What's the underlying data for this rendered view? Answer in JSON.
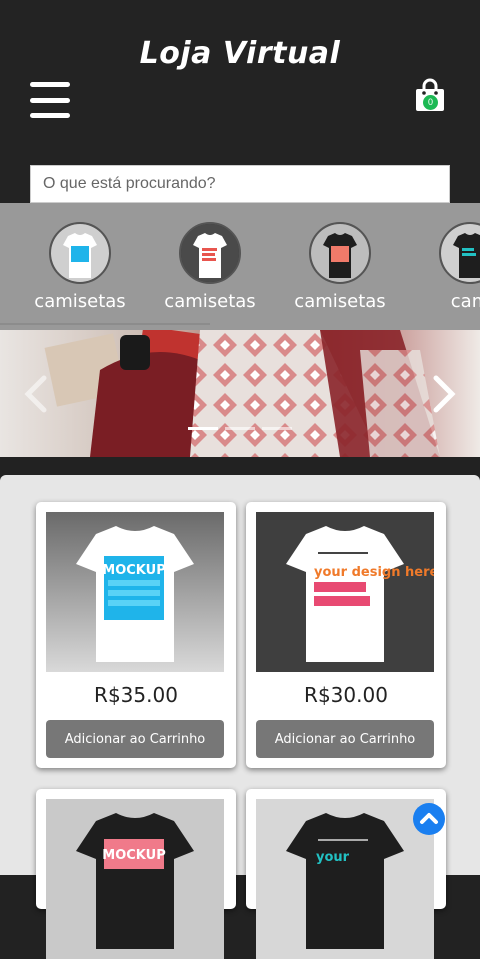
{
  "header": {
    "title": "Loja Virtual",
    "menu_icon": "hamburger-menu-icon",
    "cart_icon": "shopping-bag-icon",
    "cart_count": "0"
  },
  "search": {
    "placeholder": "O que está procurando?"
  },
  "categories": [
    {
      "label": "camisetas"
    },
    {
      "label": "camisetas"
    },
    {
      "label": "camisetas"
    },
    {
      "label": "cam"
    }
  ],
  "banner": {
    "prev_icon": "chevron-left-icon",
    "next_icon": "chevron-right-icon"
  },
  "products": [
    {
      "price": "R$35.00",
      "button": "Adicionar ao Carrinho",
      "shirt_text": "MOCKUP"
    },
    {
      "price": "R$30.00",
      "button": "Adicionar ao Carrinho",
      "shirt_text": "your design here."
    },
    {
      "shirt_text": "MOCKUP"
    },
    {
      "shirt_text": "your"
    }
  ],
  "colors": {
    "header_bg": "#232323",
    "category_strip": "#999999",
    "product_area": "#e6e6e6",
    "button_bg": "#777777",
    "cart_badge": "#1db954",
    "scroll_top": "#1a7ff0"
  }
}
